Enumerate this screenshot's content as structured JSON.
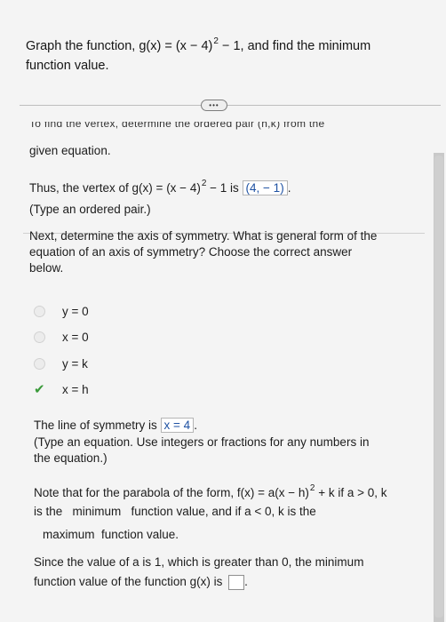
{
  "question": {
    "line1_pre": "Graph the function, g(x) = (x − 4)",
    "line1_sup": "2",
    "line1_post": " − 1, and find the minimum",
    "line2": "function value."
  },
  "more_button": "•••",
  "cut_line": "To find the vertex, determine the ordered pair (h,k) from the",
  "given_equation": "given equation.",
  "vertex": {
    "pre": "Thus, the vertex of g(x) = (x − 4)",
    "sup": "2",
    "post": " − 1 is ",
    "answer": "(4, − 1)",
    "end": ".",
    "hint": "(Type an ordered pair.)"
  },
  "axis_question": {
    "line1": "Next, determine the axis of symmetry. What is general form of the",
    "line2": "equation of an axis of symmetry? Choose the correct answer",
    "line3": "below."
  },
  "options": [
    {
      "label": "y = 0",
      "selected": false
    },
    {
      "label": "x = 0",
      "selected": false
    },
    {
      "label": "y = k",
      "selected": false
    },
    {
      "label": "x = h",
      "selected": true
    }
  ],
  "line_of_symmetry": {
    "pre": "The line of symmetry is ",
    "answer": "x = 4",
    "end": ".",
    "hint1": "(Type an equation. Use integers or fractions for any numbers in",
    "hint2": "the equation.)"
  },
  "note": {
    "line1_pre": "Note that for the parabola of the form, f(x) = a(x − h)",
    "line1_sup": "2",
    "line1_post": " + k if a > 0, k",
    "line2": "is the   minimum   function value, and if a < 0, k is the",
    "line3": "maximum  function value."
  },
  "conclusion": {
    "line1": "Since the value of a is 1, which is greater than 0, the minimum",
    "line2": "function value of the function g(x) is ",
    "end": "."
  },
  "colors": {
    "answer": "#1f52a3",
    "check": "#3a9a3a"
  }
}
